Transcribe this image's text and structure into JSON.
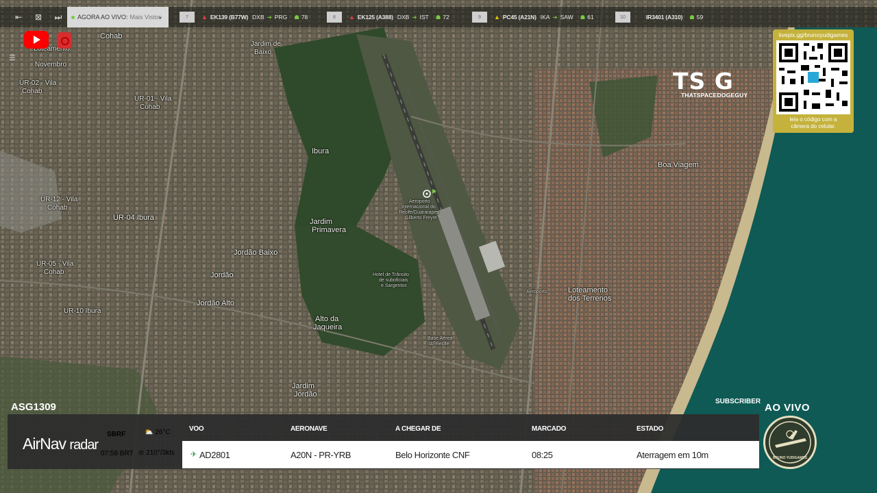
{
  "topbar": {
    "live_label": "AGORA AO VIVO:",
    "live_sub": "Mais Vistos",
    "tickers": [
      {
        "num": "7",
        "flight": "EK139 (B77W)",
        "from": "DXB",
        "to": "PRG",
        "count": "78",
        "plane_color": "red"
      },
      {
        "num": "8",
        "flight": "EK125 (A388)",
        "from": "DXB",
        "to": "IST",
        "count": "72",
        "plane_color": "red"
      },
      {
        "num": "9",
        "flight": "PC45 (A21N)",
        "from": "IKA",
        "to": "SAW",
        "count": "61",
        "plane_color": "yellow"
      },
      {
        "num": "10",
        "flight": "IR3401 (A310)",
        "from": "",
        "to": "",
        "count": "59",
        "plane_color": "none"
      }
    ]
  },
  "overlay": {
    "tsg_logo": "TS G",
    "tsg_sub": "THATSPACEDOGEGUY",
    "qr_url": "livepix.gg/brunoyudigames",
    "qr_caption_1": "leia o código com a",
    "qr_caption_2": "câmera do celular."
  },
  "map": {
    "labels": [
      {
        "text": "Cohab"
      },
      {
        "text": "Loteamento"
      },
      {
        "text": "Novembro"
      },
      {
        "text": "Jardim de"
      },
      {
        "text": "Baixo"
      },
      {
        "text": "UR-02 - Vila"
      },
      {
        "text": "Cohab"
      },
      {
        "text": "UR-01 - Vila"
      },
      {
        "text": "Cohab"
      },
      {
        "text": "Ibura"
      },
      {
        "text": "UR-12 - Vila"
      },
      {
        "text": "Cohab"
      },
      {
        "text": "UR-04 Ibura"
      },
      {
        "text": "UR-05 - Vila"
      },
      {
        "text": "Cohab"
      },
      {
        "text": "Jardim"
      },
      {
        "text": "Primavera"
      },
      {
        "text": "Jordão Baixo"
      },
      {
        "text": "Jordão"
      },
      {
        "text": "Jordão Alto"
      },
      {
        "text": "UR-10 Ibura"
      },
      {
        "text": "Alto da"
      },
      {
        "text": "Jaqueira"
      },
      {
        "text": "Jardim"
      },
      {
        "text": "Jordão"
      },
      {
        "text": "Boa Viagem"
      },
      {
        "text": "Loteamento"
      },
      {
        "text": "dos Terrenos"
      },
      {
        "text": "Aeroporto"
      },
      {
        "text": "Internacional do"
      },
      {
        "text": "Recife/Guararapes"
      },
      {
        "text": "Gilberto Freyre"
      },
      {
        "text": "Hotel de Trânsito"
      },
      {
        "text": "de suboficiais"
      },
      {
        "text": "e Sargentos"
      },
      {
        "text": "Base Aérea"
      },
      {
        "text": "do Recife"
      },
      {
        "text": "Aeroporto"
      }
    ]
  },
  "flight_panel": {
    "callsign": "ASG1309",
    "subscriber": "SUBSCRIBER",
    "brand_main": "AirNav",
    "brand_sub": "radar",
    "airport": "SBRF",
    "temp": "26°C",
    "time": "07:58 BRT",
    "wind": "210°/3kts",
    "headers": {
      "voo": "VOO",
      "aeronave": "AERONAVE",
      "chegar": "A CHEGAR DE",
      "marcado": "MARCADO",
      "estado": "ESTADO"
    },
    "row": {
      "voo": "AD2801",
      "aeronave": "A20N - PR-YRB",
      "chegar": "Belo Horizonte CNF",
      "marcado": "08:25",
      "estado": "Aterragem em 10m"
    }
  },
  "badge": {
    "ao_vivo": "AO VIVO",
    "badge_text": "BRUNO YUDIGAMES"
  }
}
